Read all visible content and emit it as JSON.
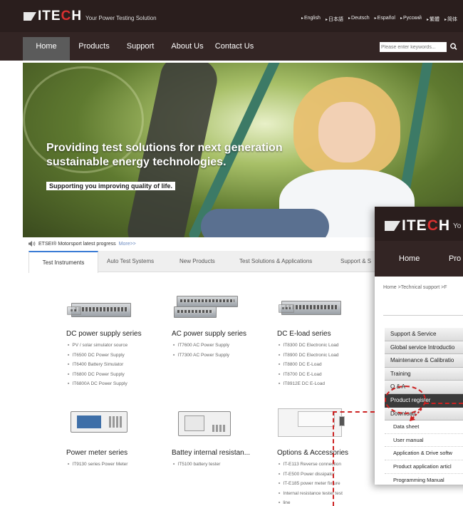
{
  "header": {
    "brand_pre": "IT",
    "brand_e": "E",
    "brand_c": "C",
    "brand_post": "H",
    "tagline": "Your Power Testing Solution",
    "languages": [
      "English",
      "日本語",
      "Deutsch",
      "Español",
      "Русский",
      "繁體",
      "简体"
    ]
  },
  "nav": {
    "items": [
      "Home",
      "Products",
      "Support",
      "About Us",
      "Contact Us"
    ],
    "search_placeholder": "Please enter keywords..."
  },
  "banner": {
    "headline": "Providing test solutions for next generation sustainable energy technologies.",
    "subline": "Supporting you improving quality of life."
  },
  "news": {
    "text": "ETSEI® Motorsport latest progress",
    "more": "More>>"
  },
  "tabs": [
    "Test Instruments",
    "Auto Test Systems",
    "New Products",
    "Test Solutions & Applications",
    "Support & S"
  ],
  "products": [
    {
      "title": "DC power supply series",
      "items": [
        "PV / solar simulator source",
        "IT6500 DC Power Supply",
        "IT6400 Battery Simulator",
        "IT6800 DC Power Supply",
        "IT6800A DC Power Supply"
      ]
    },
    {
      "title": "AC power supply series",
      "items": [
        "IT7600 AC Power Supply",
        "IT7300 AC Power Supply"
      ]
    },
    {
      "title": "DC E-load series",
      "items": [
        "IT8300 DC Electronic Load",
        "IT8900 DC Electronic Load",
        "IT8800 DC E-Load",
        "IT8700 DC E-Load",
        "IT8912E DC E-Load"
      ]
    },
    {
      "title": "Power meter series",
      "items": [
        "IT9130 series Power Meter"
      ]
    },
    {
      "title": "Battey internal resistan...",
      "items": [
        "IT5100 battery tester"
      ]
    },
    {
      "title": "Options & Accessories",
      "items": [
        "IT-E113 Reverse connection",
        "IT-E500 Power dissipator",
        "IT-E185 power meter fixture",
        "Internal resistance tester test",
        "line"
      ]
    }
  ],
  "overlay": {
    "tagline_fragment": "Yo",
    "nav": [
      "Home",
      "Pro"
    ],
    "breadcrumb": "Home >Technical support >F",
    "menu": [
      {
        "label": "Support & Service",
        "kind": "grp"
      },
      {
        "label": "Global service Introductio",
        "kind": "grp"
      },
      {
        "label": "Maintenance & Calibratio",
        "kind": "grp"
      },
      {
        "label": "Training",
        "kind": "grp"
      },
      {
        "label": "Q & A",
        "kind": "grp"
      },
      {
        "label": "Product register",
        "kind": "dark"
      },
      {
        "label": "Download",
        "kind": "grp"
      },
      {
        "label": "Data sheet",
        "kind": "sub"
      },
      {
        "label": "User manual",
        "kind": "sub"
      },
      {
        "label": "Application & Drive softw",
        "kind": "sub"
      },
      {
        "label": "Product application articl",
        "kind": "sub"
      },
      {
        "label": "Programming Manual",
        "kind": "sub"
      }
    ]
  },
  "colors": {
    "header_bg": "#2a1e1d",
    "accent": "#3a7bd5",
    "annotation": "#cc2222"
  }
}
